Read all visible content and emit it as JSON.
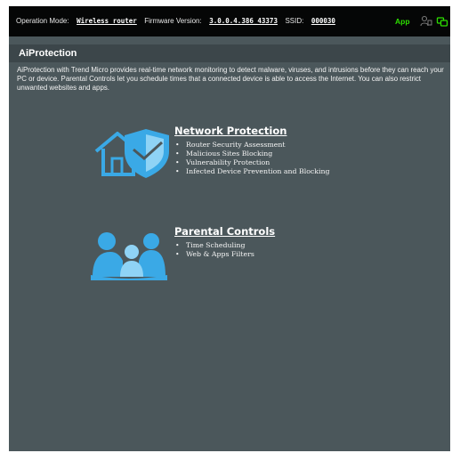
{
  "header": {
    "operation_mode_label": "Operation Mode:",
    "operation_mode_value": "Wireless router",
    "firmware_label": "Firmware Version:",
    "firmware_value": "3.0.0.4.386_43373",
    "ssid_label": "SSID:",
    "ssid_value": "000030",
    "app_label": "App",
    "icons": [
      "person-icon",
      "usb-icon"
    ],
    "app_color": "#2ddf00"
  },
  "page": {
    "title": "AiProtection",
    "description": "AiProtection with Trend Micro provides real-time network monitoring to detect malware, viruses, and intrusions before they can reach your PC or device. Parental Controls let you schedule times that a connected device is able to access the Internet. You can also restrict unwanted websites and apps."
  },
  "network_protection": {
    "title": "Network Protection",
    "icon": "house-shield-icon",
    "items": [
      "Router Security Assessment",
      "Malicious Sites Blocking",
      "Vulnerability Protection",
      "Infected Device Prevention and Blocking"
    ]
  },
  "parental_controls": {
    "title": "Parental Controls",
    "icon": "family-icon",
    "items": [
      "Time Scheduling",
      "Web & Apps Filters"
    ]
  },
  "colors": {
    "background": "#4b575b",
    "topbar": "#050606",
    "icon_blue": "#3aa9e6"
  }
}
